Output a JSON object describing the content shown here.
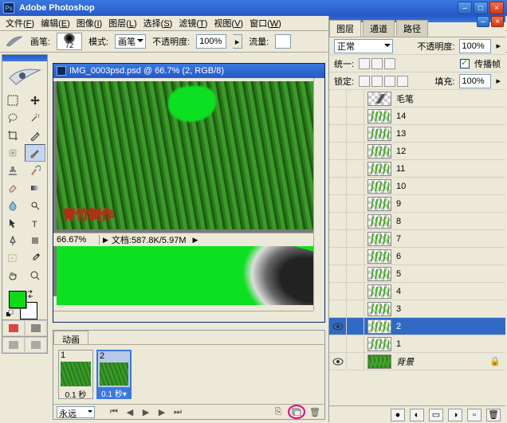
{
  "app": {
    "title": "Adobe Photoshop"
  },
  "menu": {
    "file": "文件",
    "file_u": "F",
    "edit": "编辑",
    "edit_u": "E",
    "image": "图像",
    "image_u": "I",
    "layer": "图层",
    "layer_u": "L",
    "select": "选择",
    "select_u": "S",
    "filter": "滤镜",
    "filter_u": "T",
    "view": "视图",
    "view_u": "V",
    "window": "窗口",
    "window_u": "W"
  },
  "optbar": {
    "brush_label": "画笔:",
    "brush_size": "72",
    "mode_label": "模式:",
    "mode_value": "画笔",
    "opacity_label": "不透明度:",
    "opacity_value": "100%",
    "flow_label": "流量:",
    "flow_value": ""
  },
  "doc": {
    "title": "IMG_0003psd.psd @ 66.7% (2, RGB/8)",
    "zoom": "66.67%",
    "doc_label": "文档:",
    "doc_size": "587.8K/5.97M",
    "watermark": "青竹制作"
  },
  "anim": {
    "tab": "动画",
    "frames": [
      {
        "num": "1",
        "time": "0.1 秒"
      },
      {
        "num": "2",
        "time": "0.1 秒"
      }
    ],
    "loop": "永远"
  },
  "panels": {
    "tabs": {
      "layers": "图层",
      "channels": "通道",
      "paths": "路径"
    },
    "blend_mode": "正常",
    "opacity_label": "不透明度:",
    "opacity": "100%",
    "unify_label": "统一:",
    "propagate_label": "传播帧",
    "lock_label": "锁定:",
    "fill_label": "填充:",
    "fill": "100%"
  },
  "layers": [
    {
      "name": "毛笔",
      "kind": "brush"
    },
    {
      "name": "14"
    },
    {
      "name": "13"
    },
    {
      "name": "12"
    },
    {
      "name": "11"
    },
    {
      "name": "10"
    },
    {
      "name": "9"
    },
    {
      "name": "8"
    },
    {
      "name": "7"
    },
    {
      "name": "6"
    },
    {
      "name": "5"
    },
    {
      "name": "4"
    },
    {
      "name": "3"
    },
    {
      "name": "2",
      "selected": true,
      "visible": true
    },
    {
      "name": "1"
    },
    {
      "name": "背景",
      "kind": "bg",
      "visible": true,
      "locked": true
    }
  ],
  "colors": {
    "fg": "#0bdb17",
    "bg": "#ffffff",
    "accent": "#316ac5"
  }
}
